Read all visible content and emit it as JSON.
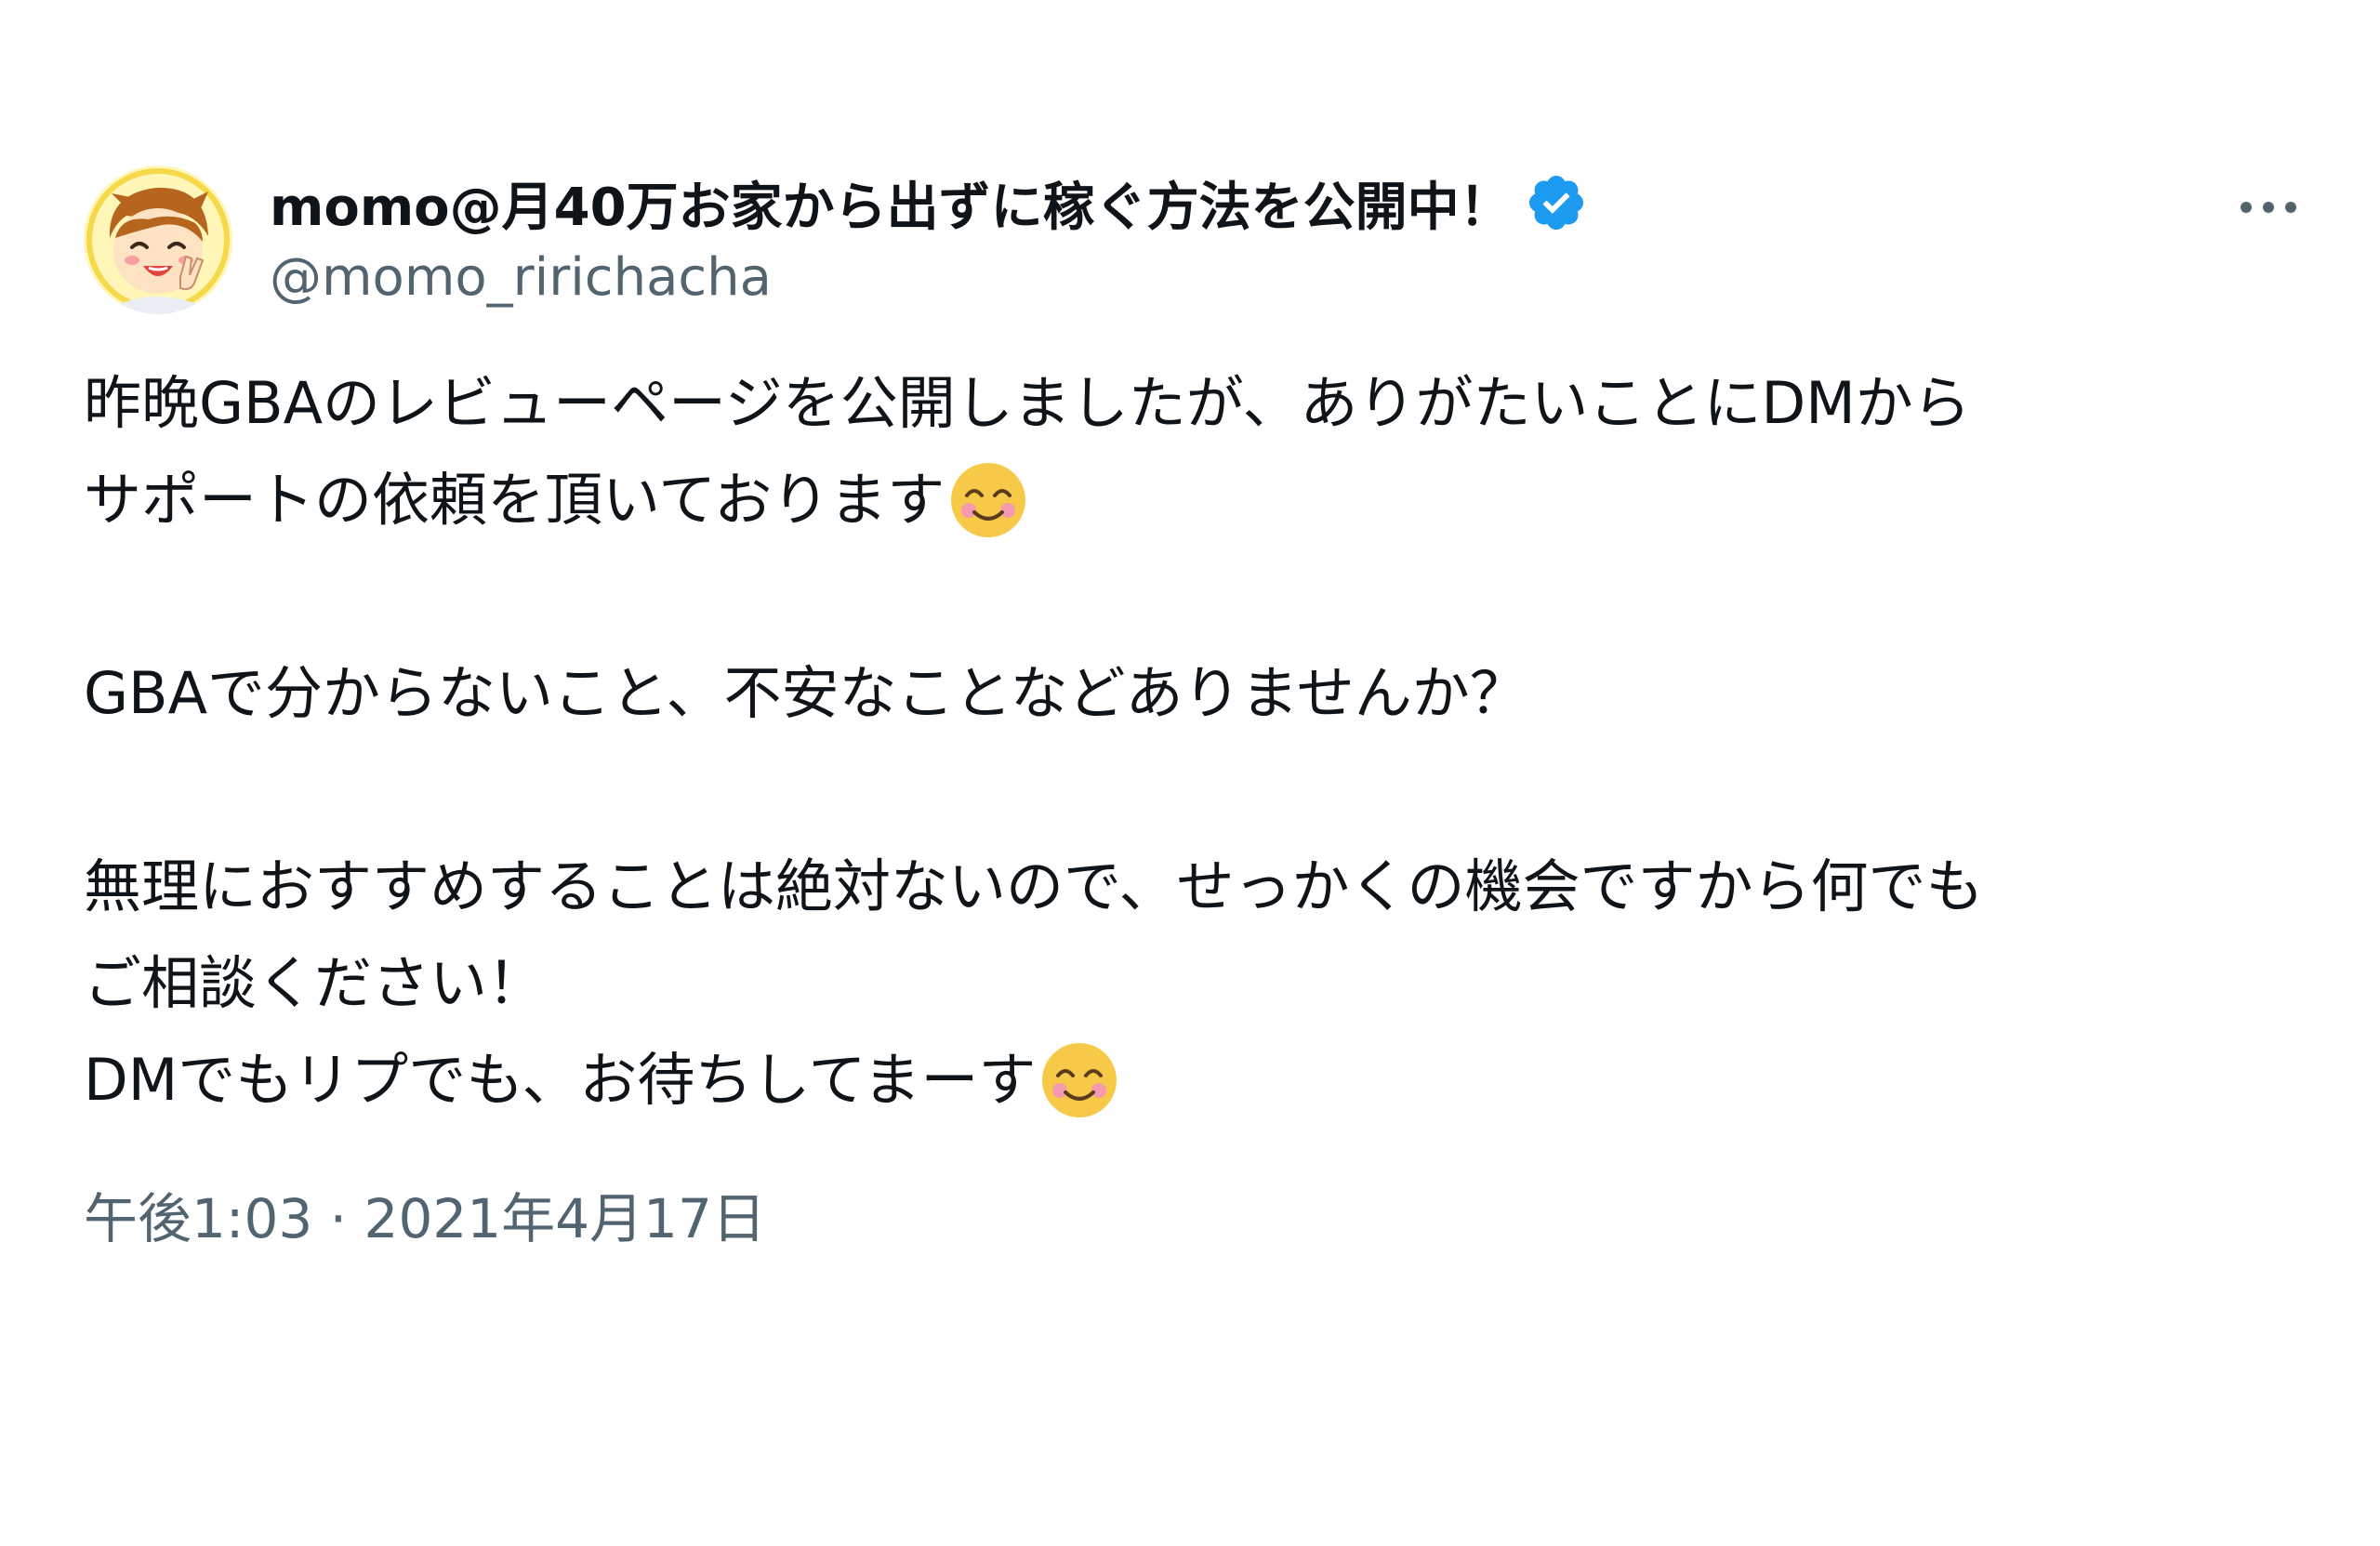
{
  "author": {
    "display_name": "momo@月40万お家から出ずに稼ぐ方法を公開中！",
    "handle": "@momo_ririchacha",
    "verified_icon": "verified-badge-icon",
    "avatar_icon": "avatar-cartoon-peace-sign"
  },
  "menu": {
    "icon": "more-options-icon"
  },
  "tweet": {
    "line1": "昨晩GBAのレビューページを公開しましたが、ありがたいことにDMから",
    "line2": "サポートの依頼を頂いております",
    "line3": "GBAで分からないこと、不安なことなどありませんか？",
    "line4": "無理におすすめすることは絶対ないので、せっかくの機会ですから何でも",
    "line5": "ご相談ください！",
    "line6": "DMでもリプでも、お待ちしてまーす",
    "emoji_icon": "smiling-face-with-smiling-eyes-emoji"
  },
  "timestamp": "午後1:03 · 2021年4月17日",
  "colors": {
    "text": "#0f1419",
    "secondary": "#536471",
    "verified": "#1d9bf0"
  }
}
